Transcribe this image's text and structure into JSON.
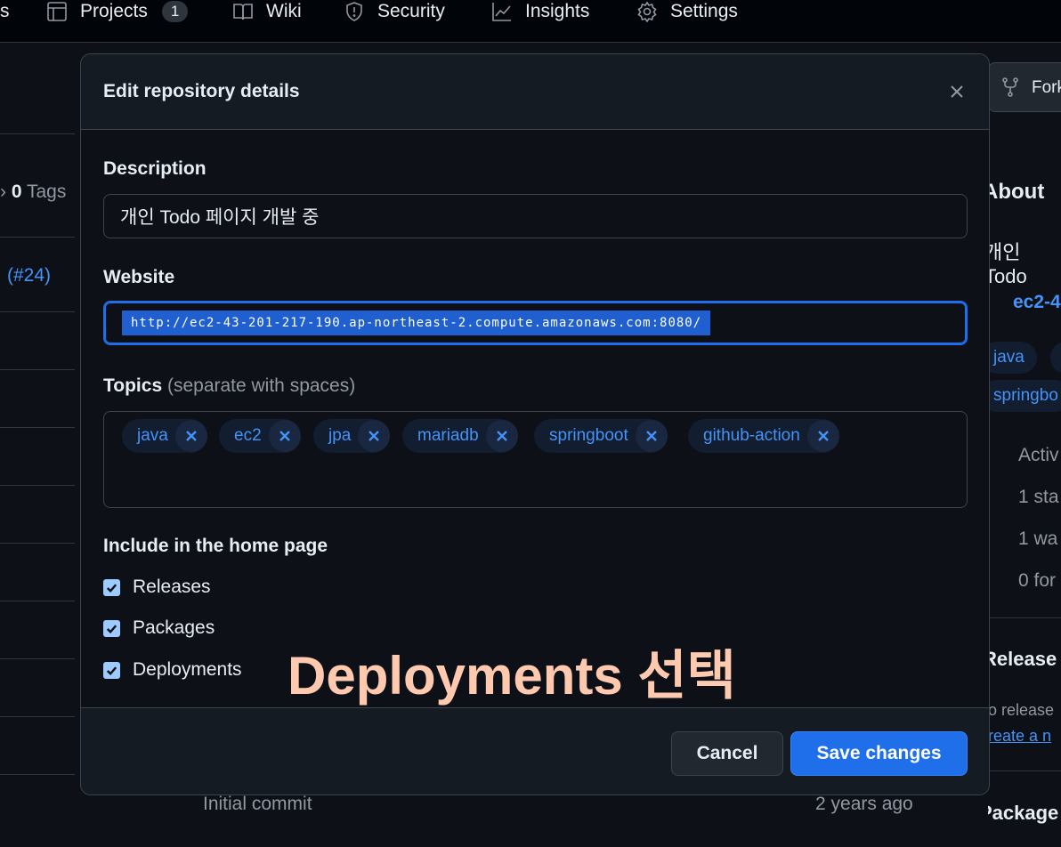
{
  "nav": {
    "partial_left": "s",
    "projects_label": "Projects",
    "projects_count": "1",
    "wiki_label": "Wiki",
    "security_label": "Security",
    "insights_label": "Insights",
    "settings_label": "Settings"
  },
  "background": {
    "tags_count": "0",
    "tags_label": "Tags",
    "pr_ref": "(#24)",
    "commit_message": "Initial commit",
    "commit_time": "2 years ago",
    "fork_label": "Fork",
    "about_label": "About",
    "about_desc": "개인 Todo",
    "website_link": "ec2-4",
    "topic_java": "java",
    "topic_springboot": "springbo",
    "activity": "Activ",
    "stars": "1 sta",
    "watch": "1 wa",
    "forks": "0 for",
    "releases_title": "Release",
    "no_releases": "o release",
    "create_release": "reate a n",
    "packages_title": "Package"
  },
  "modal": {
    "title": "Edit repository details",
    "description_label": "Description",
    "description_value": "개인 Todo 페이지 개발 중",
    "website_label": "Website",
    "website_value": "http://ec2-43-201-217-190.ap-northeast-2.compute.amazonaws.com:8080/",
    "topics_label": "Topics",
    "topics_hint": "(separate with spaces)",
    "topics": [
      "java",
      "ec2",
      "jpa",
      "mariadb",
      "springboot",
      "github-action"
    ],
    "include_label": "Include in the home page",
    "checkboxes": [
      {
        "label": "Releases",
        "checked": true
      },
      {
        "label": "Packages",
        "checked": true
      },
      {
        "label": "Deployments",
        "checked": true
      }
    ],
    "annotation": "Deployments 선택",
    "cancel_label": "Cancel",
    "save_label": "Save changes"
  },
  "colors": {
    "accent": "#1f6feb",
    "link": "#4493f8",
    "annotation": "#ffc9b0"
  }
}
